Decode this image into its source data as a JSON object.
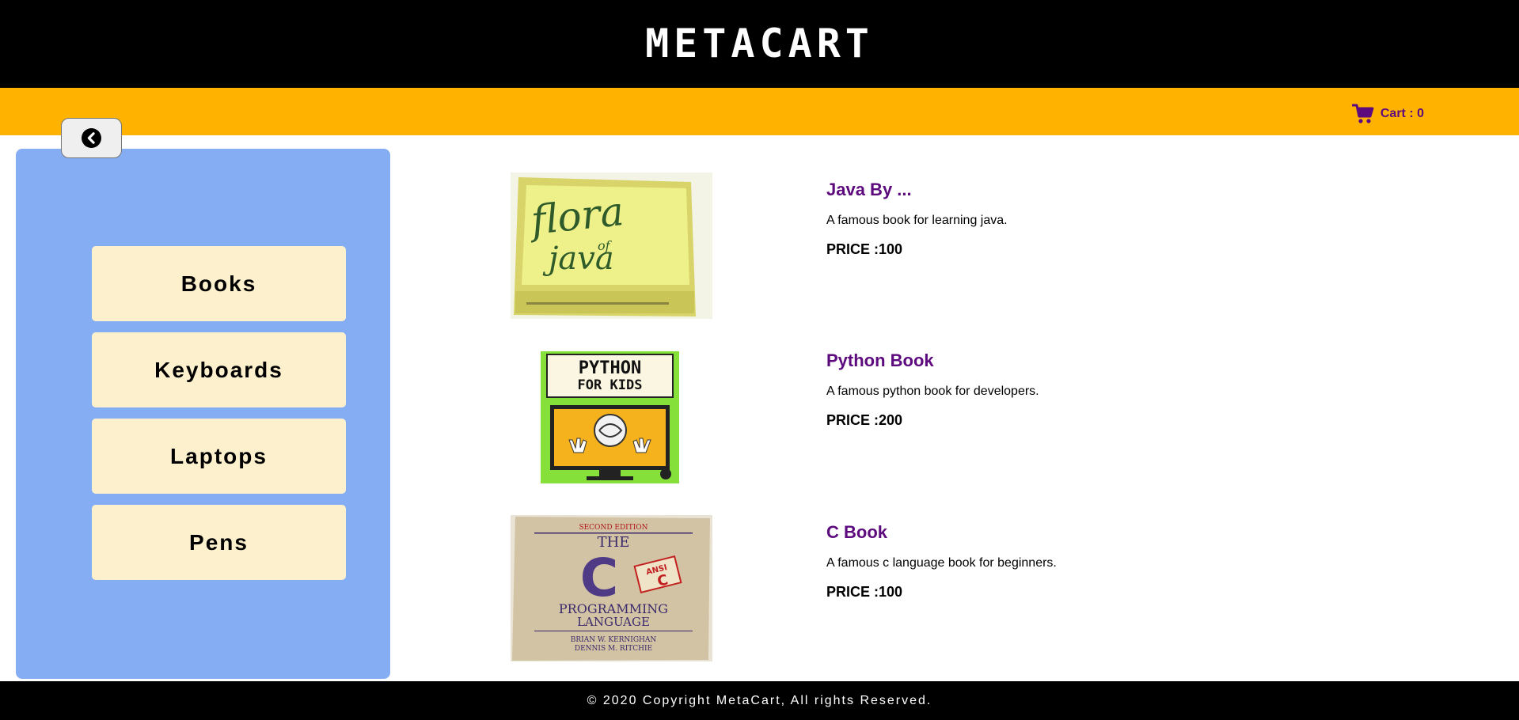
{
  "header": {
    "brand": "METACART"
  },
  "navbar": {
    "cart_label": "Cart : 0",
    "cart_icon": "shopping-cart-icon"
  },
  "sidebar": {
    "back_icon": "chevron-circle-left-icon",
    "categories": [
      {
        "label": "Books"
      },
      {
        "label": "Keyboards"
      },
      {
        "label": "Laptops"
      },
      {
        "label": "Pens"
      }
    ]
  },
  "products": [
    {
      "title": "Java By ...",
      "description": "A famous book for learning java.",
      "price": "PRICE :100",
      "cover_text": [
        "flora",
        "of",
        "java"
      ]
    },
    {
      "title": "Python Book",
      "description": "A famous python book for developers.",
      "price": "PRICE :200",
      "cover_text": [
        "PYTHON",
        "FOR KIDS"
      ]
    },
    {
      "title": "C Book",
      "description": "A famous c language book for beginners.",
      "price": "PRICE :100",
      "cover_text": [
        "SECOND EDITION",
        "THE",
        "C",
        "PROGRAMMING",
        "LANGUAGE",
        "BRIAN W. KERNIGHAN",
        "DENNIS M. RITCHIE"
      ]
    }
  ],
  "footer": {
    "copyright": "© 2020 Copyright MetaCart, All rights Reserved."
  },
  "colors": {
    "header_bg": "#000000",
    "navbar_bg": "#ffb300",
    "sidebar_bg": "#85adf3",
    "category_bg": "#fdf1cd",
    "accent_purple": "#5c0a7d"
  }
}
